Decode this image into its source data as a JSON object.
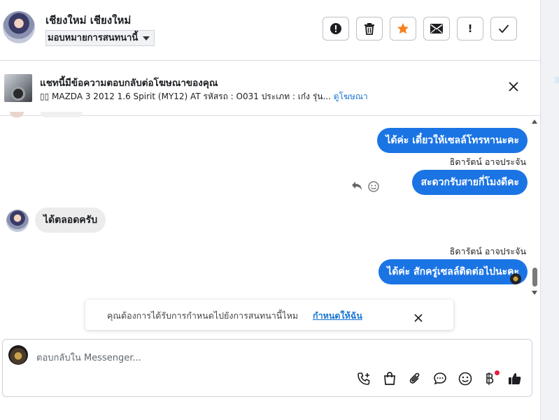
{
  "header": {
    "name": "เชียงใหม่ เชียงใหม่",
    "assign_label": "มอบหมายการสนทนานี้"
  },
  "toolbar": {
    "buttons": [
      {
        "icon": "alert-circle-icon"
      },
      {
        "icon": "trash-icon"
      },
      {
        "icon": "star-icon",
        "color": "#f5821f"
      },
      {
        "icon": "mail-icon"
      },
      {
        "icon": "exclamation-icon",
        "label": "!"
      },
      {
        "icon": "check-icon"
      }
    ]
  },
  "ad_banner": {
    "title": "แชทนี้มีข้อความตอบกลับต่อโฆษณาของคุณ",
    "subtitle": "▯▯ MAZDA 3 2012 1.6 Spirit (MY12) AT รหัสรถ : O031 ประเภท : เก๋ง รุ่น...",
    "link": "ดูโฆษณา"
  },
  "messages": [
    {
      "side": "out",
      "text": "ได้ค่ะ เดี๋ยวให้เซลล์โทรหานะคะ"
    },
    {
      "side": "out",
      "sender": "ธิดารัตน์ อาจประจัน",
      "text": "สะดวกรับสายกี่โมงดีคะ"
    },
    {
      "side": "in",
      "text": "ได้ตลอดครับ"
    },
    {
      "side": "out",
      "sender": "ธิดารัตน์ อาจประจัน",
      "text": "ได้ค่ะ สักครู่เซลล์ติดต่อไปนะคะ"
    }
  ],
  "notice": {
    "text": "คุณต้องการได้รับการกำหนดไปยังการสนทนานี้ไหม",
    "link": "กำหนดให้ฉัน"
  },
  "composer": {
    "placeholder": "ตอบกลับใน Messenger...",
    "tools": [
      "add-call-icon",
      "shopping-bag-icon",
      "paperclip-icon",
      "chat-bubble-icon",
      "emoji-icon",
      "baht-icon",
      "thumbs-up-icon"
    ]
  },
  "colors": {
    "accent": "#1b74e4",
    "link": "#1876d2",
    "star": "#f5821f"
  }
}
